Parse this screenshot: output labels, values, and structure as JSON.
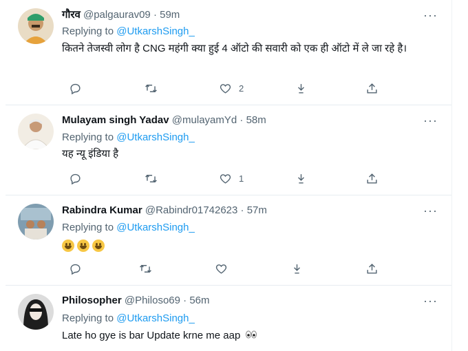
{
  "tweets": [
    {
      "name": "गौरव",
      "handle": "@palgaurav09",
      "sep": "·",
      "time": "59m",
      "reply_prefix": "Replying to",
      "reply_to": "@UtkarshSingh_",
      "text": "कितने तेजस्वी लोग है CNG महंगी क्या हुई 4 ऑटो की सवारी को एक ही ऑटो में ले जा रहे है।",
      "likes": "2",
      "avatar_color": "#d8b98a"
    },
    {
      "name": "Mulayam singh Yadav",
      "handle": "@mulayamYd",
      "sep": "·",
      "time": "58m",
      "reply_prefix": "Replying to",
      "reply_to": "@UtkarshSingh_",
      "text": "यह न्यू इंडिया है",
      "likes": "1",
      "avatar_color": "#e8e1d6"
    },
    {
      "name": "Rabindra Kumar",
      "handle": "@Rabindr01742623",
      "sep": "·",
      "time": "57m",
      "reply_prefix": "Replying to",
      "reply_to": "@UtkarshSingh_",
      "text": "",
      "emoji_count": 3,
      "likes": "",
      "avatar_color": "#6f8fa4"
    },
    {
      "name": "Philosopher",
      "handle": "@Philoso69",
      "sep": "·",
      "time": "56m",
      "reply_prefix": "Replying to",
      "reply_to": "@UtkarshSingh_",
      "text": "Late ho gye is bar Update krne me aap",
      "likes": "",
      "avatar_color": "#2a2a2a"
    }
  ],
  "more_glyph": "···",
  "icons": [
    "reply-icon",
    "retweet-icon",
    "like-icon",
    "download-icon",
    "share-icon"
  ],
  "colors": {
    "accent": "#1d9bf0",
    "muted": "#536471",
    "text": "#0f1419"
  }
}
